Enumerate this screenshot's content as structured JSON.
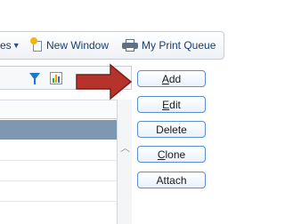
{
  "toolbar": {
    "queries_label": "es",
    "new_window_label": "New Window",
    "print_queue_label": "My Print Queue"
  },
  "actions": {
    "add": {
      "pre": "",
      "mnemonic": "A",
      "post": "dd"
    },
    "edit": {
      "pre": "",
      "mnemonic": "E",
      "post": "dit"
    },
    "delete": {
      "pre": "",
      "mnemonic": "",
      "post": "Delete"
    },
    "clone": {
      "pre": "",
      "mnemonic": "C",
      "post": "lone"
    },
    "attach": {
      "pre": "",
      "mnemonic": "",
      "post": "Attach"
    }
  },
  "icons": {
    "filter": "filter-icon",
    "chart": "chart-icon",
    "new_window": "new-window-icon",
    "print": "printer-icon",
    "annotation": "red-arrow-icon"
  },
  "colors": {
    "button_border": "#5a8fd0",
    "selected_row": "#7e98b2",
    "annotation_arrow": "#b5332b",
    "filter_icon": "#1e78c8"
  }
}
